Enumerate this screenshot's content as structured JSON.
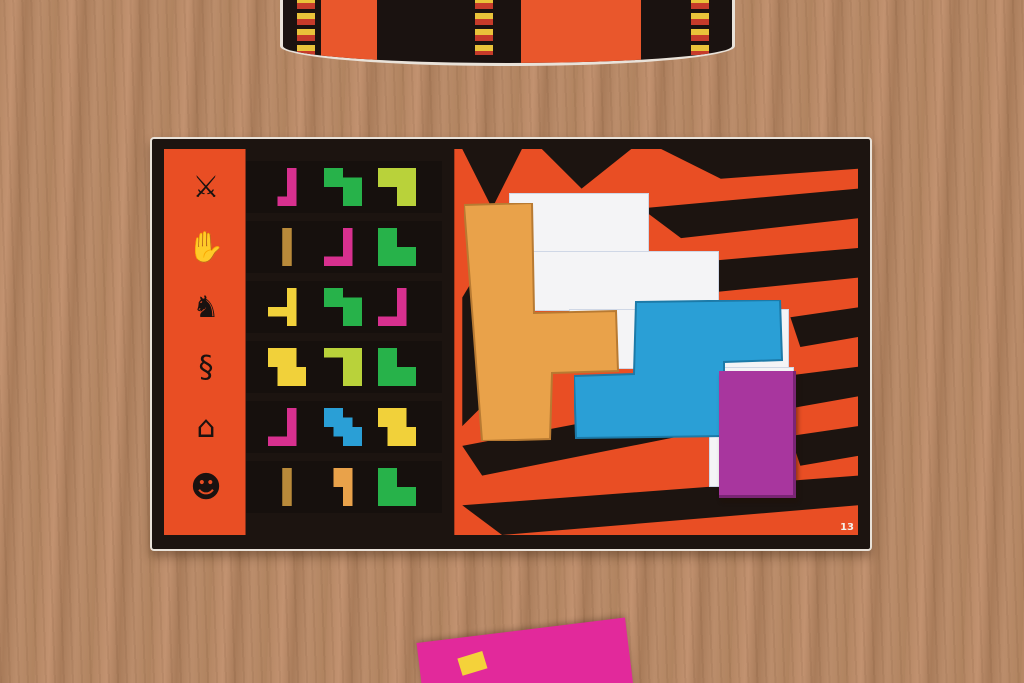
{
  "card": {
    "number": "13",
    "colors": {
      "background": "#e94e24",
      "frame": "#1c1410",
      "row_bg": "#16100d"
    }
  },
  "legend_symbols": [
    "shield-spears-icon",
    "handprint-icon",
    "gazelle-icon",
    "snake-icon",
    "hut-icon",
    "mask-icon"
  ],
  "piece_colors": {
    "magenta": "#d8308f",
    "green": "#27b24a",
    "lime": "#b9d23a",
    "yellow": "#f1d13a",
    "blue": "#2a9fd6",
    "brown": "#b98a3a",
    "orange": "#e9a24a",
    "purple": "#a8369e"
  }
}
